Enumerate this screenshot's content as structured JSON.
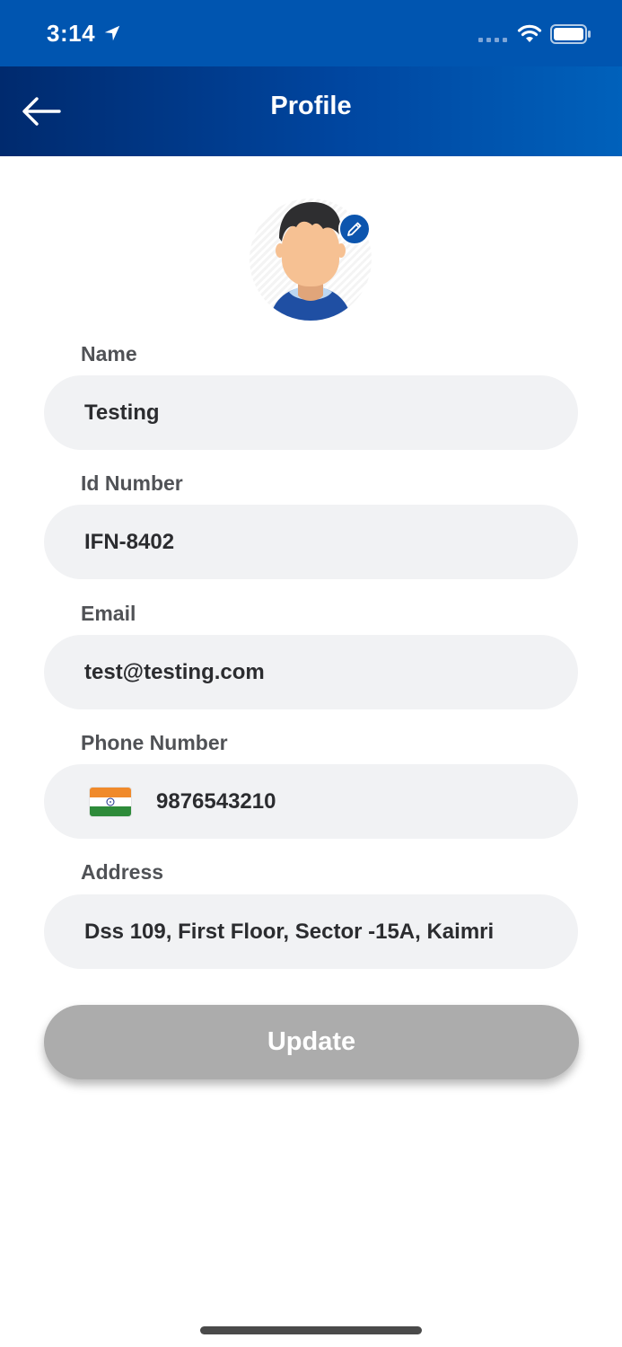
{
  "status_bar": {
    "time": "3:14",
    "icons": [
      "location-arrow-icon",
      "cellular-signal-icon",
      "wifi-icon",
      "battery-icon"
    ]
  },
  "header": {
    "title": "Profile",
    "back_icon": "arrow-left-icon"
  },
  "avatar": {
    "icon": "user-avatar-icon",
    "edit_icon": "pencil-icon"
  },
  "fields": {
    "name": {
      "label": "Name",
      "value": "Testing"
    },
    "id_number": {
      "label": "Id Number",
      "value": "IFN-8402"
    },
    "email": {
      "label": "Email",
      "value": "test@testing.com"
    },
    "phone": {
      "label": "Phone Number",
      "value": "9876543210",
      "flag_icon": "india-flag-icon"
    },
    "address": {
      "label": "Address",
      "value": "Dss 109, First Floor, Sector -15A, Kaimri"
    }
  },
  "actions": {
    "update_label": "Update"
  },
  "colors": {
    "status_bar": "#0055b0",
    "header_start": "#002a6e",
    "header_end": "#0061bb",
    "field_background": "#f1f2f4",
    "button_disabled": "#acacac",
    "edit_badge": "#0c55ae"
  }
}
